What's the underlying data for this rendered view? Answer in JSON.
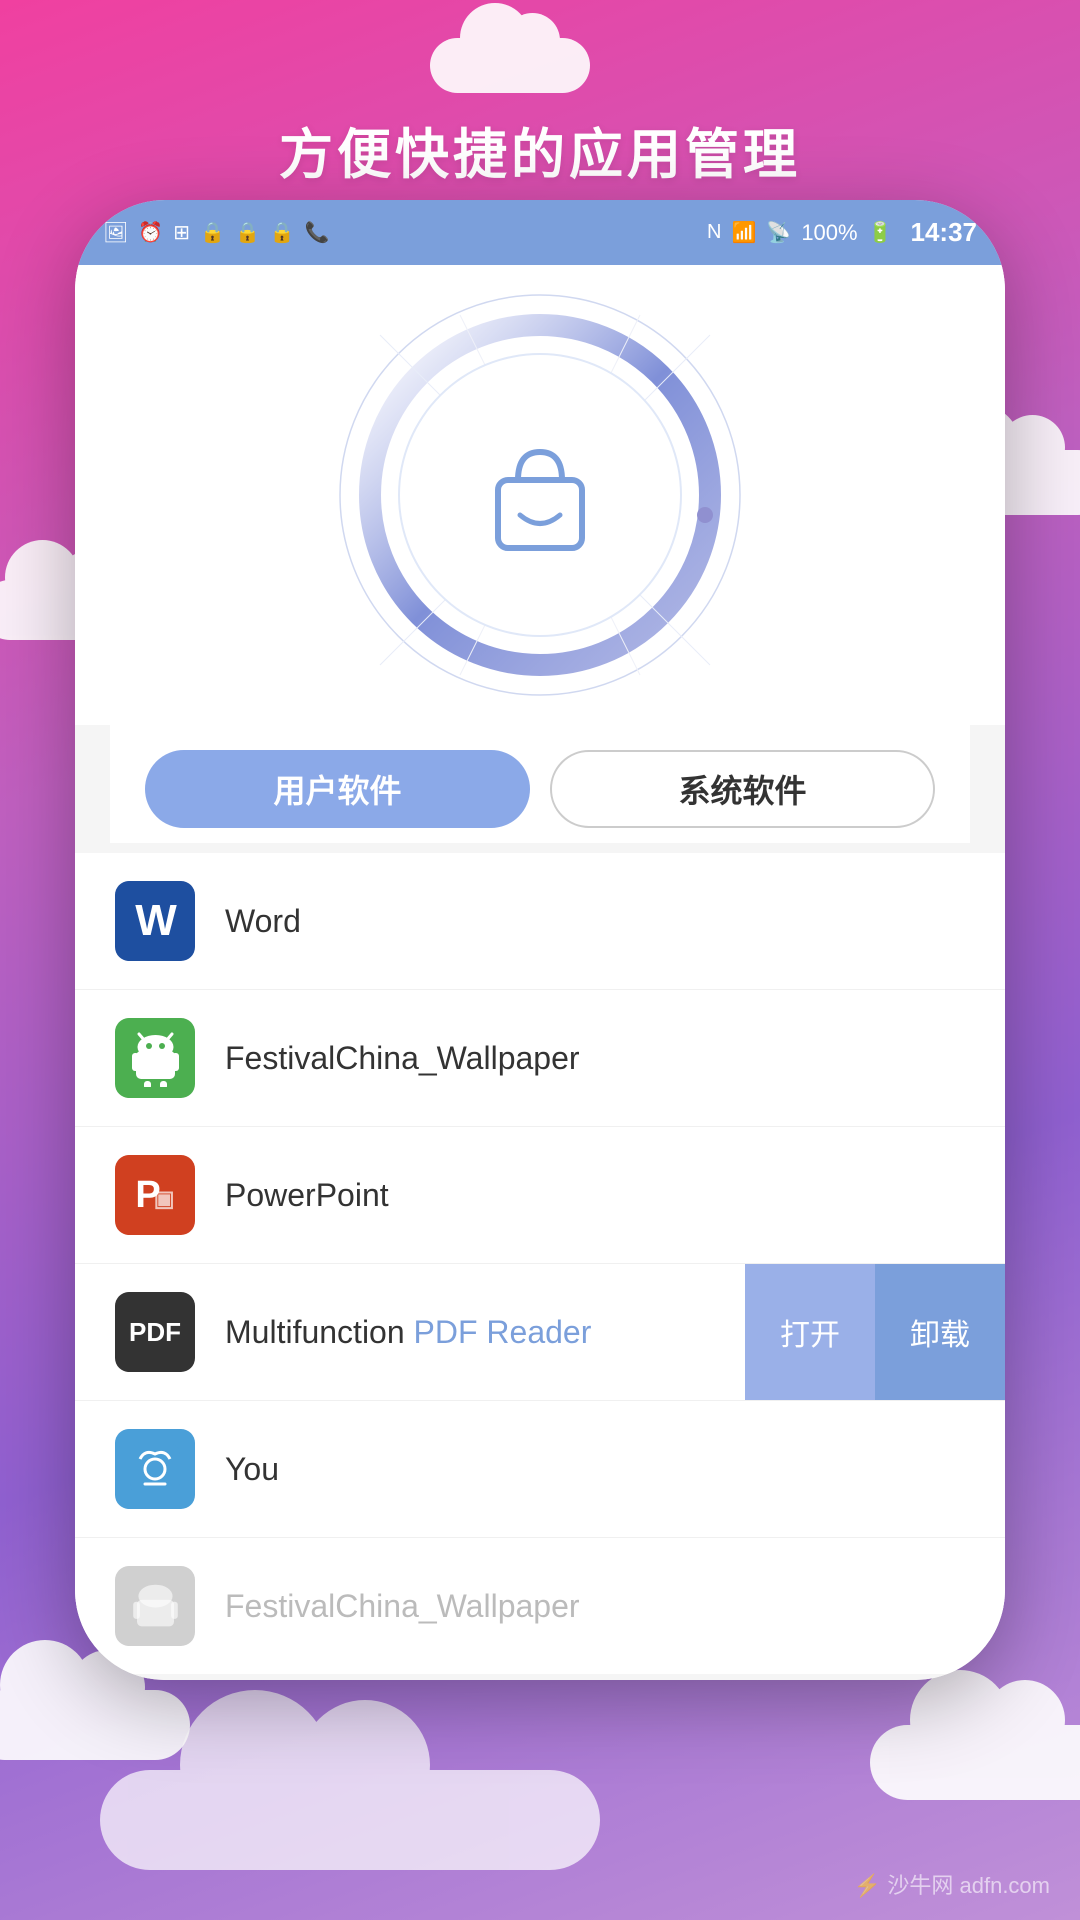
{
  "page": {
    "title": "方便快捷的应用管理",
    "background_gradient_start": "#f040a0",
    "background_gradient_end": "#c080d0"
  },
  "status_bar": {
    "time": "14:37",
    "battery": "100%",
    "signal": "WiFi"
  },
  "tabs": {
    "user_software": "用户软件",
    "system_software": "系统软件"
  },
  "app_list": [
    {
      "id": "word",
      "name": "Word",
      "icon_type": "word"
    },
    {
      "id": "festival",
      "name": "FestivalChina_Wallpaper",
      "icon_type": "android"
    },
    {
      "id": "powerpoint",
      "name": "PowerPoint",
      "icon_type": "ppt"
    },
    {
      "id": "pdf",
      "name": "Multifunction PDF Reader",
      "icon_type": "pdf",
      "has_actions": true
    },
    {
      "id": "you",
      "name": "You",
      "icon_type": "you"
    },
    {
      "id": "festival2",
      "name": "FestivalChina_Wallpaper",
      "icon_type": "festival_gray",
      "is_gray": true
    }
  ],
  "actions": {
    "open": "打开",
    "uninstall": "卸载"
  },
  "watermark": "沙牛网 adfn.com"
}
